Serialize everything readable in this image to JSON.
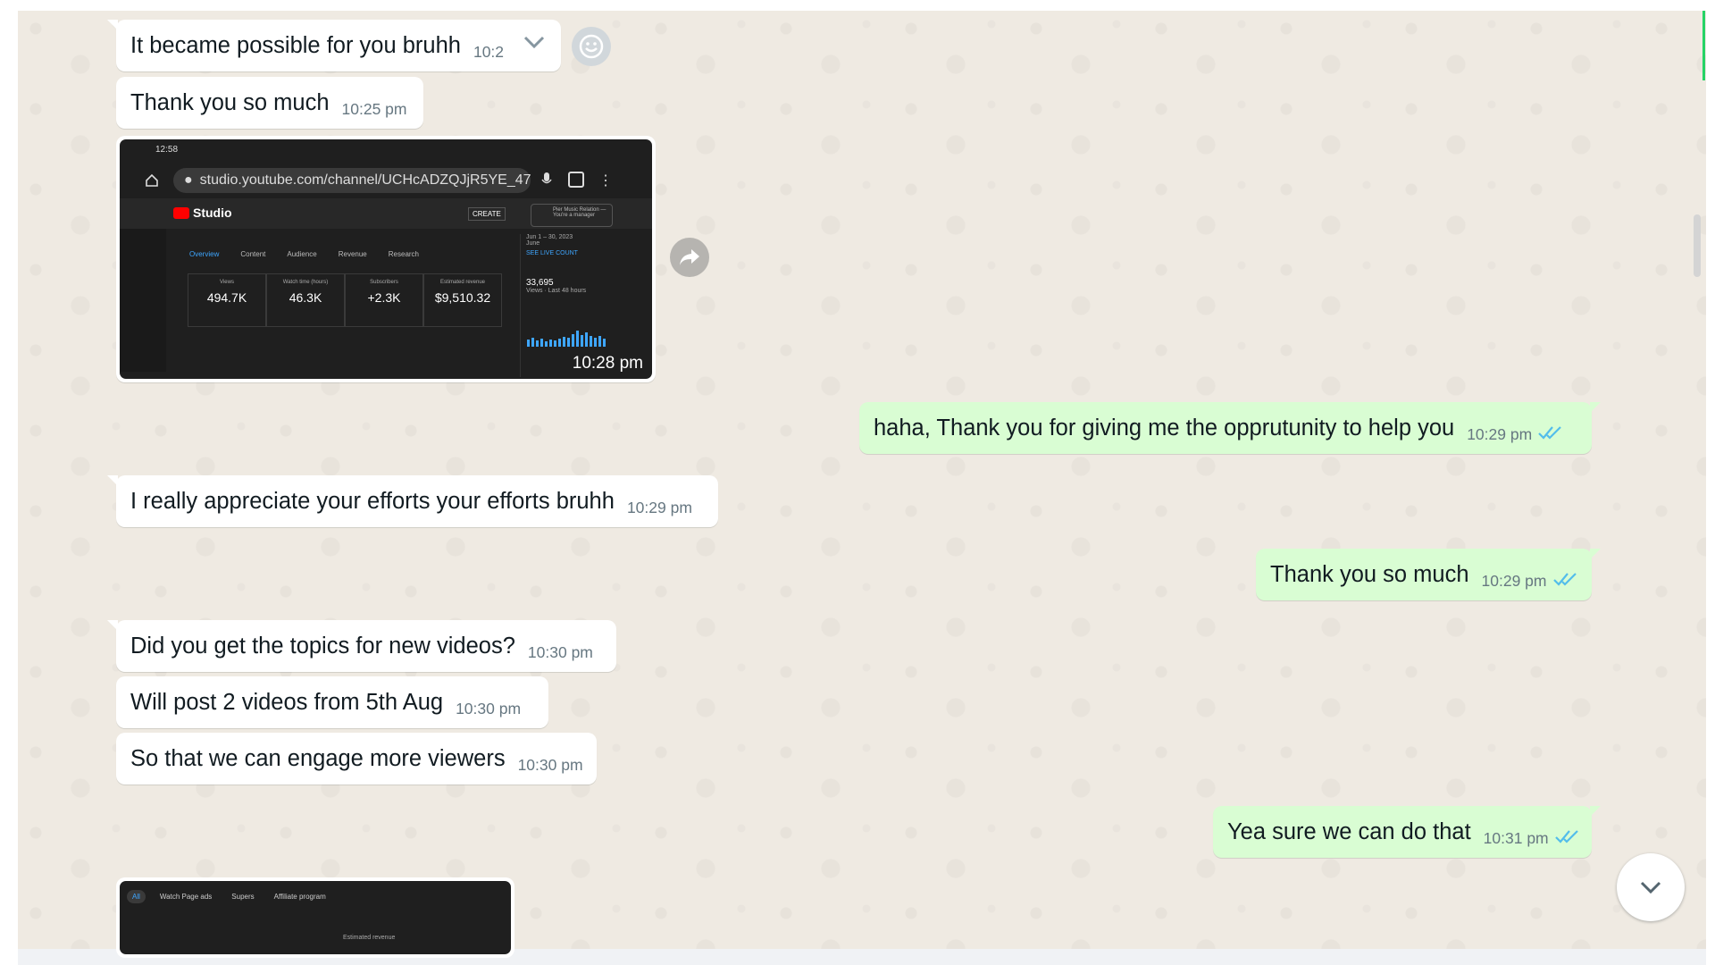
{
  "messages": [
    {
      "dir": "in",
      "text": "It became possible for you bruhh",
      "time": "10:2"
    },
    {
      "dir": "in",
      "text": "Thank you so much",
      "time": "10:25 pm"
    },
    {
      "dir": "out",
      "text": "haha, Thank you for giving me the opprutunity to help you",
      "time": "10:29 pm"
    },
    {
      "dir": "in",
      "text": "I really appreciate your efforts your efforts bruhh",
      "time": "10:29 pm"
    },
    {
      "dir": "out",
      "text": "Thank you so much",
      "time": "10:29 pm"
    },
    {
      "dir": "in",
      "text": "Did you get the topics for new videos?",
      "time": "10:30 pm"
    },
    {
      "dir": "in",
      "text": "Will post 2 videos from 5th Aug",
      "time": "10:30 pm"
    },
    {
      "dir": "in",
      "text": "So that we can engage more viewers",
      "time": "10:30 pm"
    },
    {
      "dir": "out",
      "text": "Yea sure we can do that",
      "time": "10:31 pm"
    }
  ],
  "image_message": {
    "time": "10:28 pm",
    "status_time": "12:58",
    "url": "studio.youtube.com/channel/UCHcADZQJjR5YE_47",
    "studio_label": "Studio",
    "create_label": "CREATE",
    "channel_label": "Pier Music Relation — You're a manager",
    "tabs": [
      "Overview",
      "Content",
      "Audience",
      "Revenue",
      "Research"
    ],
    "stats": [
      {
        "label": "Views",
        "value": "494.7K"
      },
      {
        "label": "Watch time (hours)",
        "value": "46.3K"
      },
      {
        "label": "Subscribers",
        "value": "+2.3K"
      },
      {
        "label": "Estimated revenue",
        "value": "$9,510.32"
      }
    ],
    "right_panel": {
      "range": "Jun 1 – 30, 2023",
      "month": "June",
      "live_label": "SEE LIVE COUNT",
      "count": "33,695",
      "sub": "Views · Last 48 hours"
    }
  },
  "image_message_2": {
    "chips": [
      "All",
      "Watch Page ads",
      "Supers",
      "Affiliate program"
    ],
    "revenue_label": "Estimated revenue"
  },
  "colors": {
    "incoming": "#ffffff",
    "outgoing": "#d9fdd3",
    "read_ticks": "#53bdeb",
    "background": "#efeae2"
  },
  "icons": {
    "react": "smiley-icon",
    "dropdown": "chevron-down-icon",
    "forward": "forward-icon",
    "scroll": "scroll-down-icon",
    "ticks": "double-check-icon"
  }
}
